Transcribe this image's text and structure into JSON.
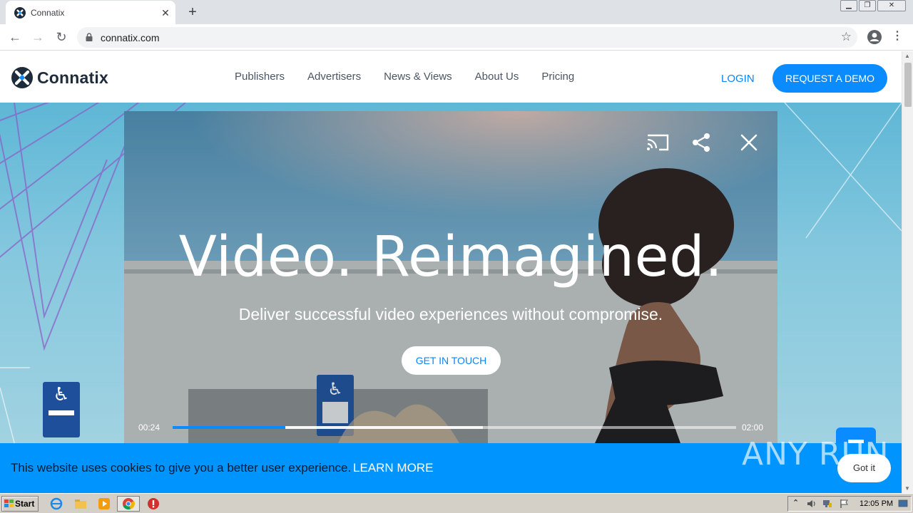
{
  "browser": {
    "tab_title": "Connatix",
    "tab_close": "✕",
    "new_tab": "+",
    "url": "connatix.com",
    "back": "←",
    "forward": "→",
    "reload": "↻",
    "star": "☆",
    "menu": "⋮"
  },
  "site": {
    "logo_text": "Connatix",
    "nav": [
      "Publishers",
      "Advertisers",
      "News & Views",
      "About Us",
      "Pricing"
    ],
    "login": "LOGIN",
    "demo_button": "REQUEST A DEMO"
  },
  "hero": {
    "title": "Video. Reimagined.",
    "subtitle": "Deliver successful video experiences without compromise.",
    "cta": "GET IN TOUCH"
  },
  "player": {
    "time_current": "00:24",
    "time_total": "02:00",
    "progress_fraction": 0.2,
    "buffered_fraction": 0.55,
    "icons": [
      "cast-icon",
      "share-icon",
      "close-icon"
    ]
  },
  "cookie": {
    "text": "This website uses cookies to give you a better user experience.",
    "link": "LEARN MORE",
    "button": "Got it"
  },
  "watermark": "ANY RUN",
  "taskbar": {
    "start": "Start",
    "clock": "12:05 PM"
  },
  "colors": {
    "accent": "#0a8bff",
    "cookie_bar": "#0094ff",
    "header_text": "#1d2b3a"
  }
}
